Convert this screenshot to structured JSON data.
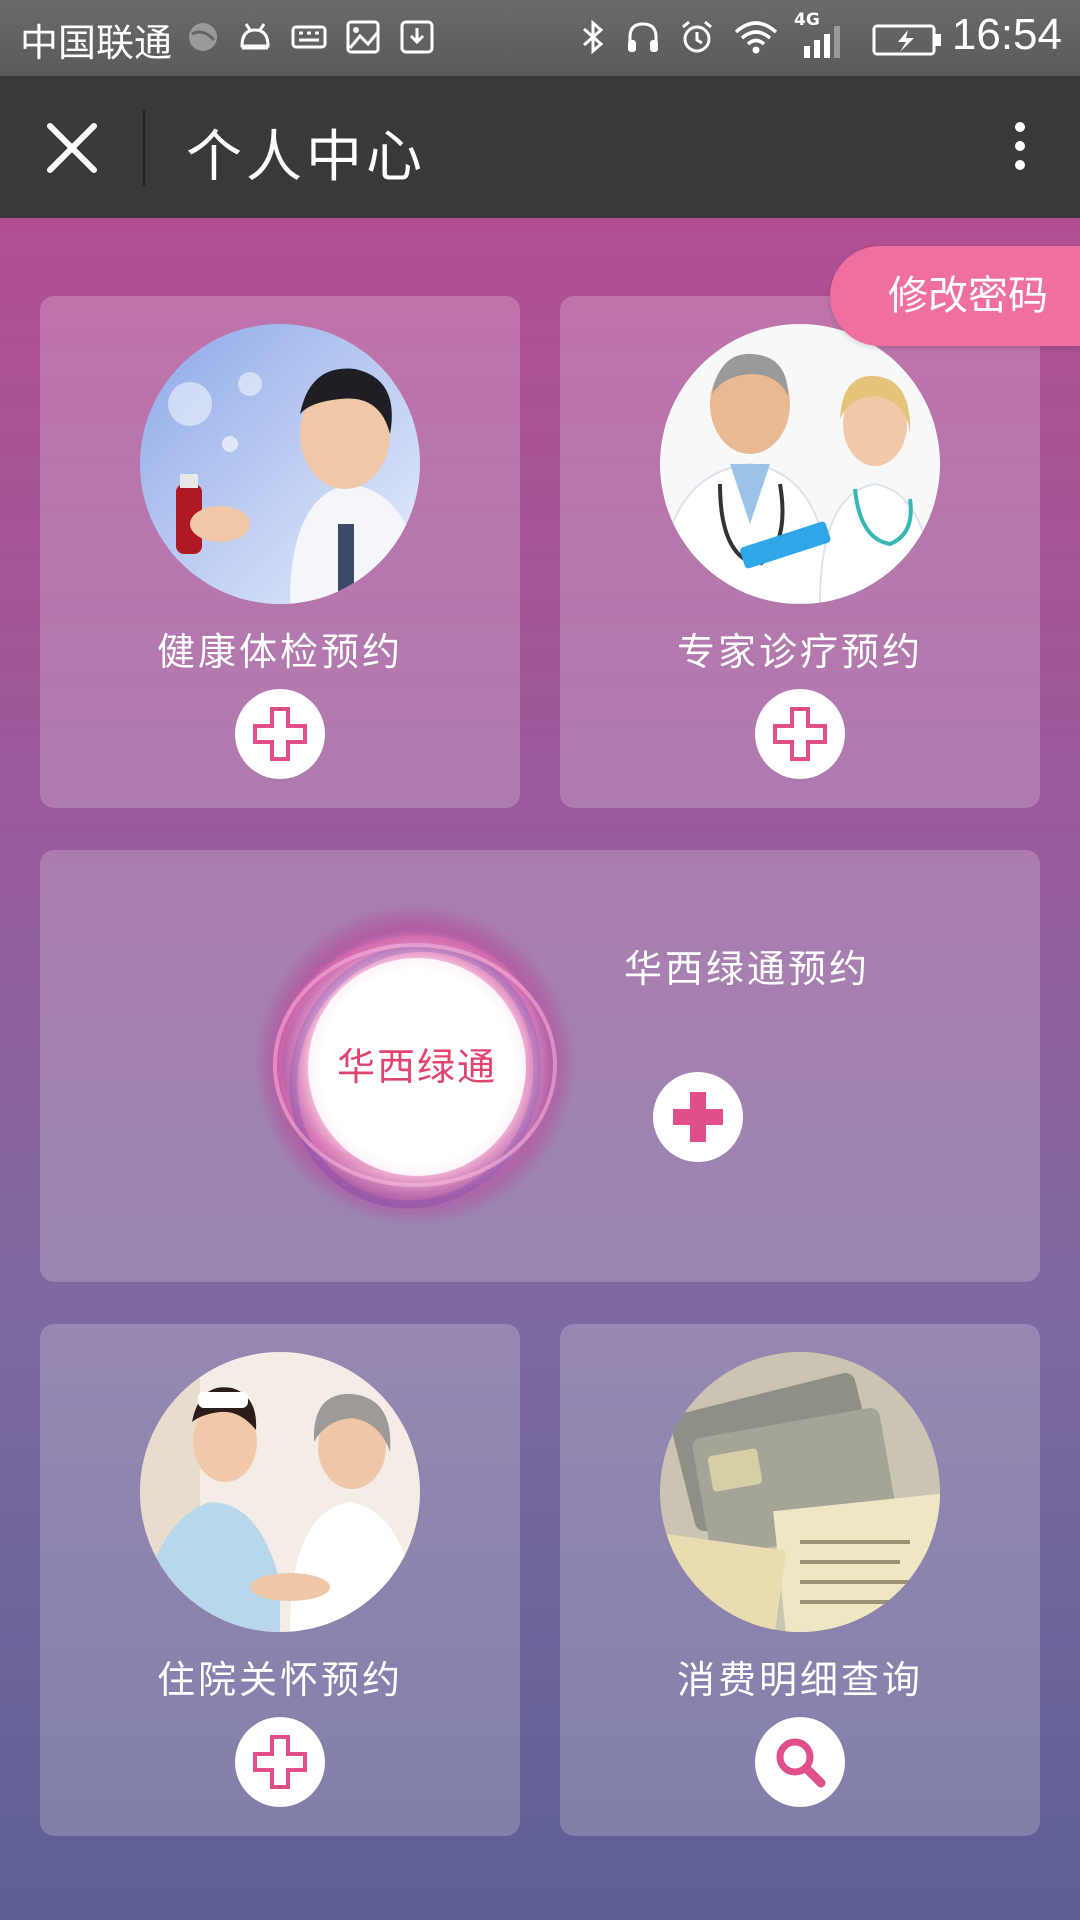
{
  "status_bar": {
    "carrier": "中国联通",
    "network": "4G",
    "time": "16:54",
    "icons": [
      "globe-icon",
      "android-icon",
      "keyboard-icon",
      "image-icon",
      "download-icon",
      "bluetooth-icon",
      "headphones-icon",
      "alarm-icon",
      "wifi-icon",
      "signal-icon",
      "battery-charging-icon"
    ]
  },
  "app_bar": {
    "title": "个人中心",
    "close_icon": "close-icon",
    "menu_icon": "more-vertical-icon"
  },
  "change_password_label": "修改密码",
  "cards": [
    {
      "label": "健康体检预约",
      "image": "doctor-with-test-tube-photo",
      "action_icon": "plus-outline-icon"
    },
    {
      "label": "专家诊疗预约",
      "image": "two-doctors-photo",
      "action_icon": "plus-outline-icon"
    },
    {
      "label": "华西绿通预约",
      "badge_text": "华西绿通",
      "action_icon": "plus-solid-icon"
    },
    {
      "label": "住院关怀预约",
      "image": "nurse-with-elderly-patient-photo",
      "action_icon": "plus-outline-icon"
    },
    {
      "label": "消费明细查询",
      "image": "credit-cards-and-receipts-photo",
      "action_icon": "search-icon"
    }
  ],
  "colors": {
    "accent": "#ee6fa0",
    "icon_pink": "#e04f8a",
    "appbar_bg": "#393939",
    "gradient_top": "#b24f93",
    "gradient_bottom": "#5d5f94"
  }
}
